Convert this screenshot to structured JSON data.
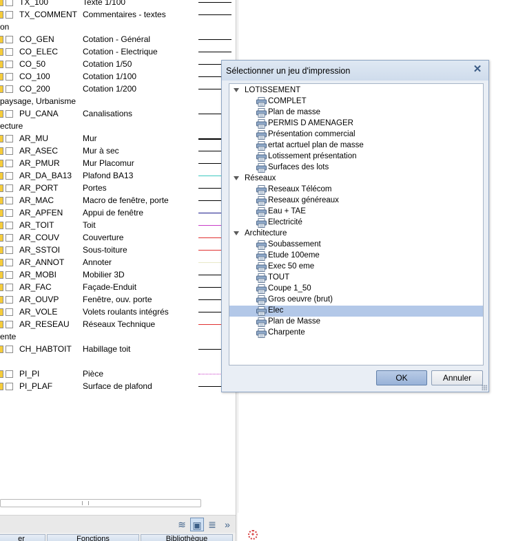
{
  "layers": {
    "rows": [
      {
        "kind": "layer",
        "code": "TX_100",
        "desc": "Texte 1/100",
        "line": "#000000",
        "line_style": "solid"
      },
      {
        "kind": "layer",
        "code": "TX_COMMENT",
        "desc": "Commentaires - textes",
        "line": "#000000",
        "line_style": "solid"
      },
      {
        "kind": "group",
        "label": "on"
      },
      {
        "kind": "layer",
        "code": "CO_GEN",
        "desc": "Cotation - Général",
        "line": "#000000",
        "line_style": "solid"
      },
      {
        "kind": "layer",
        "code": "CO_ELEC",
        "desc": "Cotation - Electrique",
        "line": "#000000",
        "line_style": "solid"
      },
      {
        "kind": "layer",
        "code": "CO_50",
        "desc": "Cotation 1/50",
        "line": "#000000",
        "line_style": "solid"
      },
      {
        "kind": "layer",
        "code": "CO_100",
        "desc": "Cotation 1/100",
        "line": "#000000",
        "line_style": "solid"
      },
      {
        "kind": "layer",
        "code": "CO_200",
        "desc": "Cotation 1/200",
        "line": "#000000",
        "line_style": "solid"
      },
      {
        "kind": "group",
        "label": "paysage, Urbanisme"
      },
      {
        "kind": "layer",
        "code": "PU_CANA",
        "desc": "Canalisations",
        "line": "#000000",
        "line_style": "solid"
      },
      {
        "kind": "group",
        "label": "ecture"
      },
      {
        "kind": "layer",
        "code": "AR_MU",
        "desc": "Mur",
        "line": "#000000",
        "line_style": "thick"
      },
      {
        "kind": "layer",
        "code": "AR_ASEC",
        "desc": "Mur à sec",
        "line": "#000000",
        "line_style": "solid"
      },
      {
        "kind": "layer",
        "code": "AR_PMUR",
        "desc": "Mur Placomur",
        "line": "#000000",
        "line_style": "solid"
      },
      {
        "kind": "layer",
        "code": "AR_DA_BA13",
        "desc": "Plafond BA13",
        "line": "#3cc8c0",
        "line_style": "solid"
      },
      {
        "kind": "layer",
        "code": "AR_PORT",
        "desc": "Portes",
        "line": "#000000",
        "line_style": "solid"
      },
      {
        "kind": "layer",
        "code": "AR_MAC",
        "desc": "Macro de fenêtre, porte",
        "line": "#000000",
        "line_style": "solid"
      },
      {
        "kind": "layer",
        "code": "AR_APFEN",
        "desc": "Appui de fenêtre",
        "line": "#1a1a8c",
        "line_style": "solid"
      },
      {
        "kind": "layer",
        "code": "AR_TOIT",
        "desc": "Toit",
        "line": "#c83cc8",
        "line_style": "solid"
      },
      {
        "kind": "layer",
        "code": "AR_COUV",
        "desc": "Couverture",
        "line": "#e03030",
        "line_style": "solid"
      },
      {
        "kind": "layer",
        "code": "AR_SSTOI",
        "desc": "Sous-toiture",
        "line": "#e03030",
        "line_style": "solid"
      },
      {
        "kind": "layer",
        "code": "AR_ANNOT",
        "desc": "Annoter",
        "line": "#e8e8c8",
        "line_style": "solid"
      },
      {
        "kind": "layer",
        "code": "AR_MOBI",
        "desc": "Mobilier 3D",
        "line": "#000000",
        "line_style": "solid"
      },
      {
        "kind": "layer",
        "code": "AR_FAC",
        "desc": "Façade-Enduit",
        "line": "#000000",
        "line_style": "solid"
      },
      {
        "kind": "layer",
        "code": "AR_OUVP",
        "desc": "Fenêtre, ouv. porte",
        "line": "#000000",
        "line_style": "solid"
      },
      {
        "kind": "layer",
        "code": "AR_VOLE",
        "desc": "Volets roulants intégrés",
        "line": "#000000",
        "line_style": "solid"
      },
      {
        "kind": "layer",
        "code": "AR_RESEAU",
        "desc": "Réseaux Technique",
        "line": "#e03030",
        "line_style": "solid"
      },
      {
        "kind": "group",
        "label": "ente"
      },
      {
        "kind": "layer",
        "code": "CH_HABTOIT",
        "desc": "Habillage toit",
        "line": "#000000",
        "line_style": "solid"
      },
      {
        "kind": "gap"
      },
      {
        "kind": "layer",
        "code": "PI_PI",
        "desc": "Pièce",
        "line": "#c83cc8",
        "line_style": "dotted"
      },
      {
        "kind": "layer",
        "code": "PI_PLAF",
        "desc": "Surface de plafond",
        "line": "#000000",
        "line_style": "solid"
      }
    ]
  },
  "tabs": [
    {
      "label": "er"
    },
    {
      "label": "Fonctions"
    },
    {
      "label": "Bibliothèque"
    }
  ],
  "dialog": {
    "title": "Sélectionner un jeu d'impression",
    "close_symbol": "✕",
    "ok_label": "OK",
    "cancel_label": "Annuler",
    "item_icon": "print-set-icon",
    "tree": [
      {
        "group": "LOTISSEMENT",
        "items": [
          "COMPLET",
          "Plan de masse",
          "PERMIS D AMENAGER",
          "Présentation commercial",
          "ertat acrtuel plan de masse",
          "Lotissement présentation",
          "Surfaces des lots"
        ]
      },
      {
        "group": "Réseaux",
        "items": [
          "Reseaux Télécom",
          "Reseaux généreaux",
          "Eau + TAE",
          "Electricité"
        ]
      },
      {
        "group": "Architecture",
        "items": [
          "Soubassement",
          "Etude 100eme",
          "Exec 50 eme",
          "TOUT",
          "Coupe 1_50",
          "Gros oeuvre (brut)",
          "Elec",
          "Plan de Masse",
          "Charpente"
        ]
      }
    ],
    "selected": "Elec"
  },
  "colors": {
    "accent": "#b3c8e8",
    "layer_checkbox": "#f6cc3a",
    "dialog_border": "#8ea5c4"
  }
}
